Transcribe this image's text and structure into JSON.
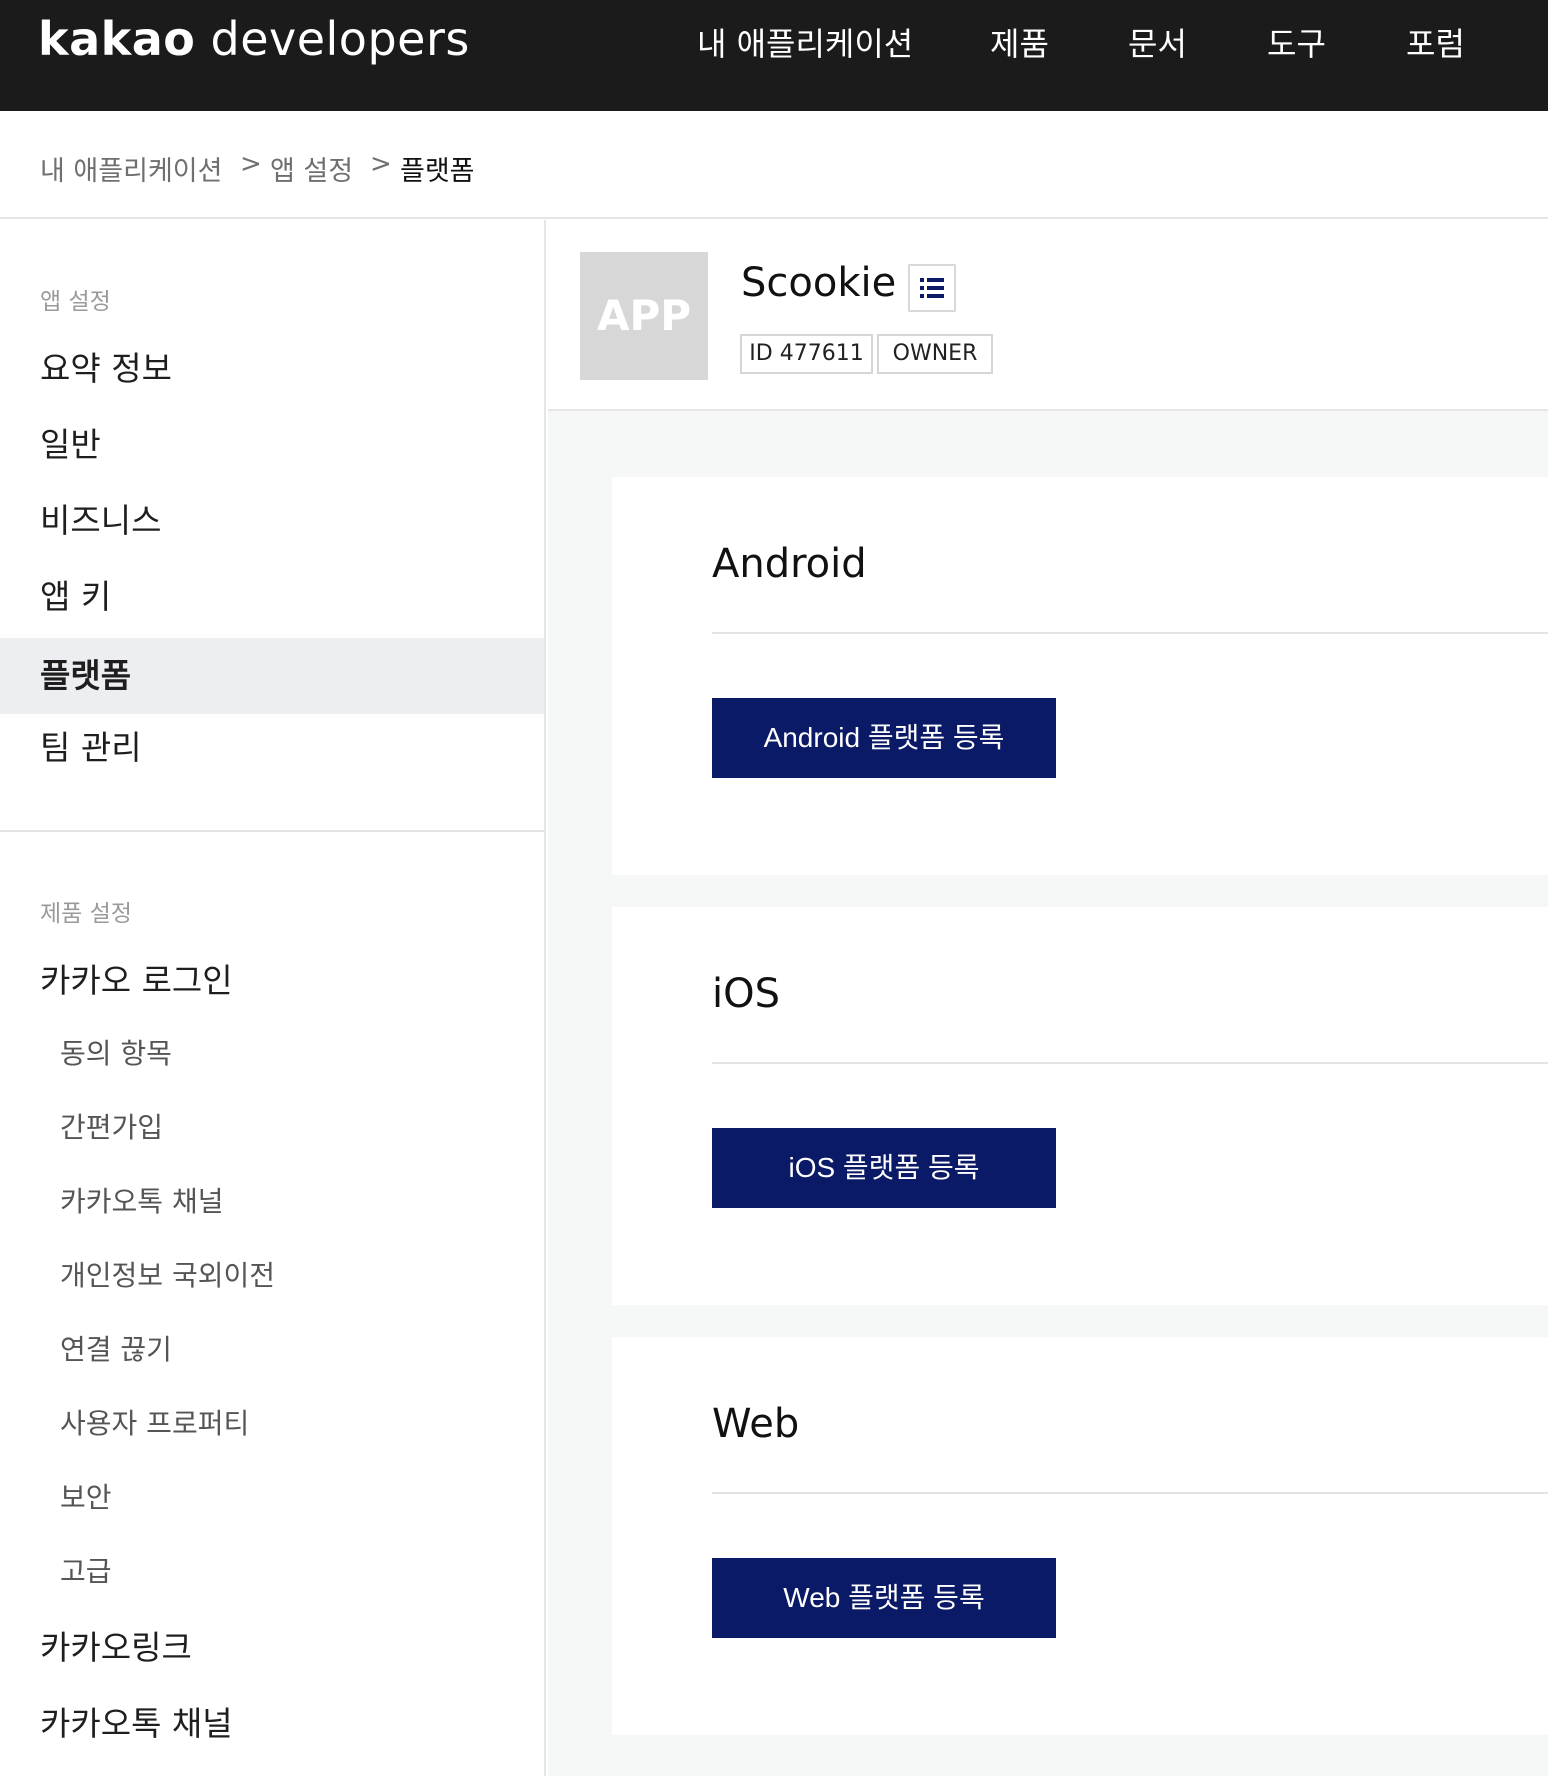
{
  "header": {
    "logo_a": "kakao",
    "logo_b": " developers",
    "nav": [
      "내 애플리케이션",
      "제품",
      "문서",
      "도구",
      "포럼"
    ]
  },
  "breadcrumb": {
    "items": [
      "내 애플리케이션",
      "앱 설정",
      "플랫폼"
    ],
    "separator": ">"
  },
  "sidebar": {
    "app_section_title": "앱 설정",
    "app_items": [
      "요약 정보",
      "일반",
      "비즈니스",
      "앱 키",
      "플랫폼",
      "팀 관리"
    ],
    "active_item": "플랫폼",
    "product_section_title": "제품 설정",
    "product_items": [
      {
        "label": "카카오 로그인"
      },
      {
        "label": "동의 항목",
        "sub": true
      },
      {
        "label": "간편가입",
        "sub": true
      },
      {
        "label": "카카오톡 채널",
        "sub": true
      },
      {
        "label": "개인정보 국외이전",
        "sub": true
      },
      {
        "label": "연결 끊기",
        "sub": true
      },
      {
        "label": "사용자 프로퍼티",
        "sub": true
      },
      {
        "label": "보안",
        "sub": true
      },
      {
        "label": "고급",
        "sub": true
      },
      {
        "label": "카카오링크"
      },
      {
        "label": "카카오톡 채널"
      }
    ]
  },
  "app": {
    "thumb_text": "APP",
    "name": "Scookie",
    "id_tag": "ID 477611",
    "role_tag": "OWNER",
    "menu_icon": "list-icon"
  },
  "platforms": [
    {
      "title": "Android",
      "button": "Android 플랫폼 등록"
    },
    {
      "title": "iOS",
      "button": "iOS 플랫폼 등록"
    },
    {
      "title": "Web",
      "button": "Web 플랫폼 등록"
    }
  ],
  "colors": {
    "topbar_bg": "#1b1b1b",
    "button_bg": "#0b1a66",
    "active_item_bg": "#eceef2",
    "main_bg": "#f6f7f7"
  }
}
